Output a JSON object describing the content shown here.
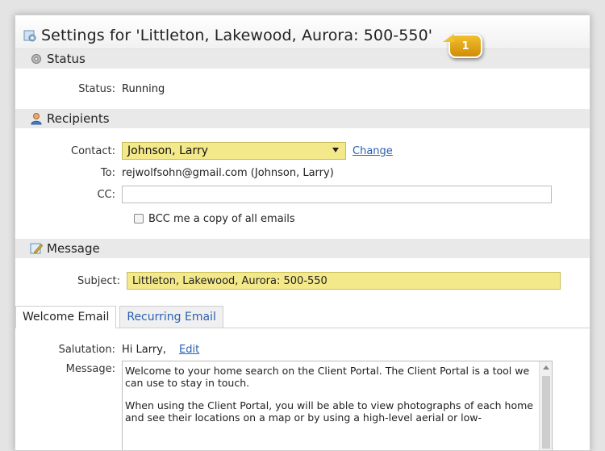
{
  "title": "Settings for 'Littleton, Lakewood, Aurora: 500-550'",
  "callout_number": "1",
  "sections": {
    "status": {
      "header": "Status",
      "status_label": "Status:",
      "status_value": "Running"
    },
    "recipients": {
      "header": "Recipients",
      "contact_label": "Contact:",
      "contact_value": "Johnson, Larry",
      "change_link": "Change",
      "to_label": "To:",
      "to_value": "rejwolfsohn@gmail.com (Johnson, Larry)",
      "cc_label": "CC:",
      "cc_value": "",
      "bcc_label": "BCC me a copy of all emails"
    },
    "message": {
      "header": "Message",
      "subject_label": "Subject:",
      "subject_value": "Littleton, Lakewood, Aurora: 500-550"
    }
  },
  "tabs": [
    {
      "label": "Welcome Email",
      "active": true
    },
    {
      "label": "Recurring Email",
      "active": false
    }
  ],
  "welcome": {
    "salutation_label": "Salutation:",
    "salutation_value": "Hi Larry,",
    "edit_link": "Edit",
    "message_label": "Message:",
    "message_para1": "Welcome to your home search on the Client Portal. The Client Portal is a tool we can use to stay in touch.",
    "message_para2": "When using the Client Portal, you will be able to view photographs of each home and see their locations on a map or by using a high-level aerial or low-"
  },
  "colors": {
    "highlight_field": "#f4e98a",
    "link": "#2a5fb0",
    "callout": "#e0a41c",
    "section_header": "#e9e9e9"
  },
  "icons": {
    "title": "settings-page-icon",
    "status": "gear-icon",
    "recipients": "person-icon",
    "message": "compose-icon"
  }
}
